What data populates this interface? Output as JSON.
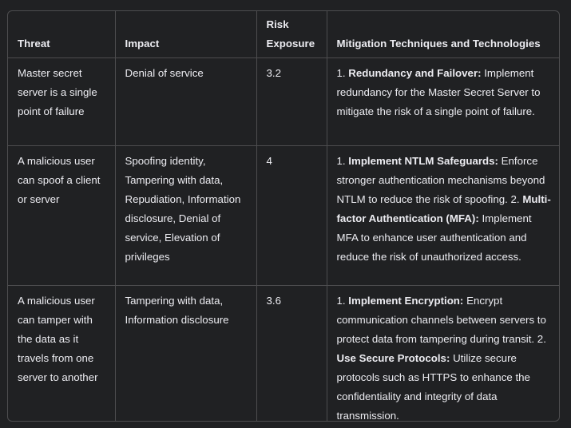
{
  "headers": {
    "threat": "Threat",
    "impact": "Impact",
    "risk": "Risk Exposure",
    "mitigation": "Mitigation Techniques and Technologies"
  },
  "rows": [
    {
      "threat": "Master secret server is a single point of failure",
      "impact": "Denial of service",
      "risk": "3.2",
      "mitigation": [
        {
          "num": "1. ",
          "title": "Redundancy and Failover:",
          "text": " Implement redundancy for the Master Secret Server to mitigate the risk of a single point of failure."
        }
      ]
    },
    {
      "threat": "A malicious user can spoof a client or server",
      "impact": "Spoofing identity, Tampering with data, Repudiation, Information disclosure, Denial of service, Elevation of privileges",
      "risk": "4",
      "mitigation": [
        {
          "num": "1. ",
          "title": "Implement NTLM Safeguards:",
          "text": " Enforce stronger authentication mechanisms beyond NTLM to reduce the risk of spoofing. "
        },
        {
          "num": "2. ",
          "title": "Multi-factor Authentication (MFA):",
          "text": " Implement MFA to enhance user authentication and reduce the risk of unauthorized access."
        }
      ]
    },
    {
      "threat": "A malicious user can tamper with the data as it travels from one server to another",
      "impact": "Tampering with data, Information disclosure",
      "risk": "3.6",
      "mitigation": [
        {
          "num": "1. ",
          "title": "Implement Encryption:",
          "text": " Encrypt communication channels between servers to protect data from tampering during transit. "
        },
        {
          "num": "2. ",
          "title": "Use Secure Protocols:",
          "text": " Utilize secure protocols such as HTTPS to enhance the confidentiality and integrity of data transmission."
        }
      ]
    }
  ]
}
